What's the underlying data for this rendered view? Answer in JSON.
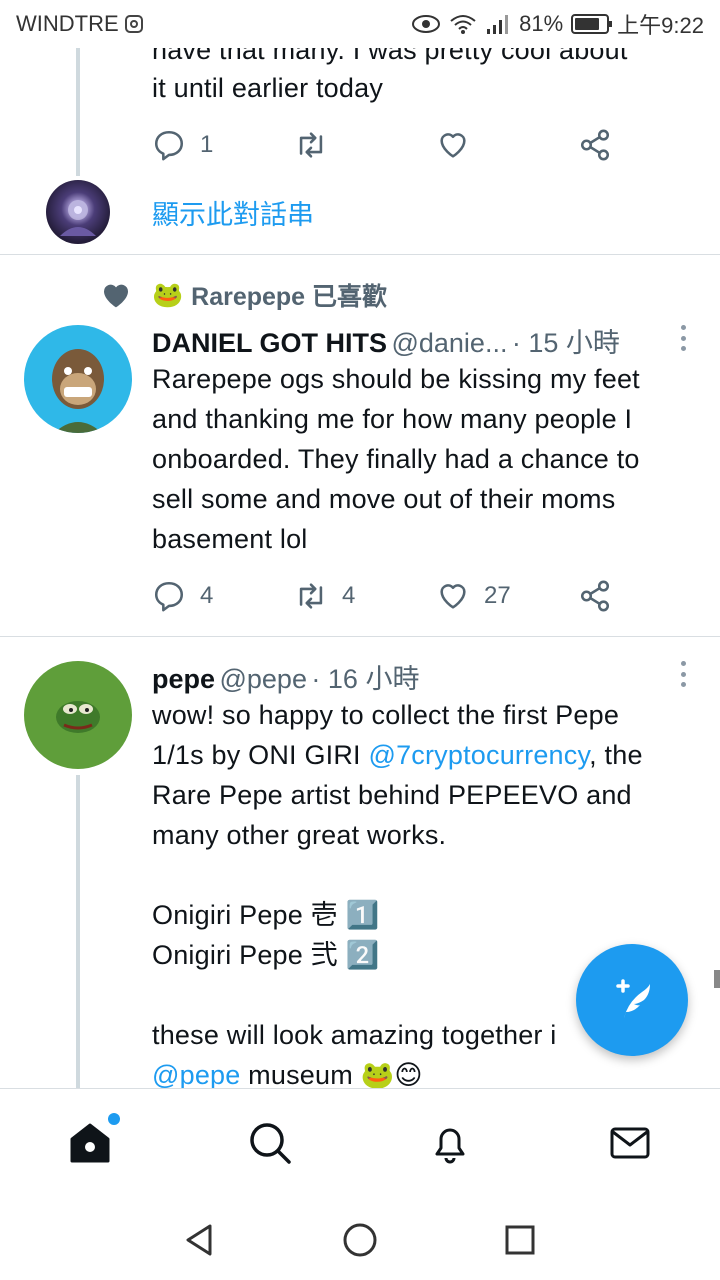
{
  "status_bar": {
    "carrier": "WINDTRE",
    "battery": "81%",
    "battery_level": 0.81,
    "time": "上午9:22"
  },
  "tweet1": {
    "text_partial_top": "have that many. I was pretty cool about",
    "text_line2": "it until earlier today",
    "reply_count": "1",
    "show_thread": "顯示此對話串"
  },
  "tweet2": {
    "liked_by": "Rarepepe 已喜歡",
    "liked_by_emoji": "🐸",
    "name": "DANIEL GOT HITS",
    "handle": "@danie...",
    "time": "· 15 小時",
    "text": "Rarepepe ogs should be kissing my feet\nand thanking me for how many people I\nonboarded. They finally had a chance to\nsell some and move out of their moms\nbasement lol",
    "reply_count": "4",
    "retweet_count": "4",
    "like_count": "27"
  },
  "tweet3": {
    "name": "pepe",
    "handle": "@pepe",
    "time": "· 16 小時",
    "line1": "wow! so happy to collect the first Pepe",
    "line2_pre": "1/1s by ONI GIRI ",
    "line2_link": "@7cryptocurrency",
    "line2_post": ", the",
    "line3": "Rare Pepe artist behind PEPEEVO and",
    "line4": "many other great works.",
    "line5": "Onigiri Pepe 壱 1️⃣",
    "line6": "Onigiri Pepe 弐 2️⃣",
    "line7": "these will look amazing together i",
    "line8_link": "@pepe",
    "line8_post": " museum 🐸😊"
  },
  "icons": {
    "reply": "reply-icon",
    "retweet": "retweet-icon",
    "like": "heart-icon",
    "share": "share-icon",
    "compose": "compose-icon",
    "home": "home-icon",
    "search": "search-icon",
    "notifications": "bell-icon",
    "messages": "mail-icon"
  },
  "colors": {
    "accent": "#1d9bf0",
    "text": "#0f1419",
    "muted": "#536471"
  }
}
